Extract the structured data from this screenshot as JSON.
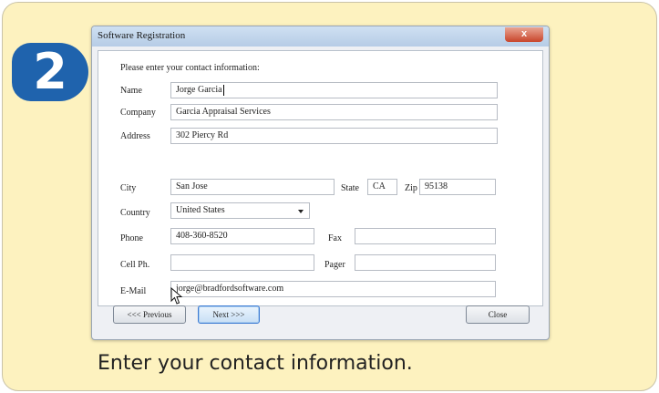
{
  "step_number": "2",
  "window": {
    "title": "Software Registration",
    "close_glyph": "x",
    "prompt": "Please enter your contact information:"
  },
  "form": {
    "name": {
      "label": "Name",
      "value": "Jorge Garcia"
    },
    "company": {
      "label": "Company",
      "value": "Garcia Appraisal Services"
    },
    "address": {
      "label": "Address",
      "value": "302 Piercy Rd"
    },
    "city": {
      "label": "City",
      "value": "San Jose"
    },
    "state": {
      "label": "State",
      "value": "CA"
    },
    "zip": {
      "label": "Zip",
      "value": "95138"
    },
    "country": {
      "label": "Country",
      "value": "United States"
    },
    "phone": {
      "label": "Phone",
      "value": "408-360-8520"
    },
    "fax": {
      "label": "Fax",
      "value": ""
    },
    "cell": {
      "label": "Cell Ph.",
      "value": ""
    },
    "pager": {
      "label": "Pager",
      "value": ""
    },
    "email": {
      "label": "E-Mail",
      "value": "jorge@bradfordsoftware.com"
    }
  },
  "buttons": {
    "previous": "<<< Previous",
    "next": "Next >>>",
    "close": "Close"
  },
  "caption": "Enter your contact information.",
  "colors": {
    "card_background": "#fdf2bf",
    "step_badge": "#1f63ad",
    "close_button": "#c8442a"
  },
  "icons": [
    "close-icon",
    "dropdown-arrow-icon",
    "mouse-pointer-icon"
  ]
}
